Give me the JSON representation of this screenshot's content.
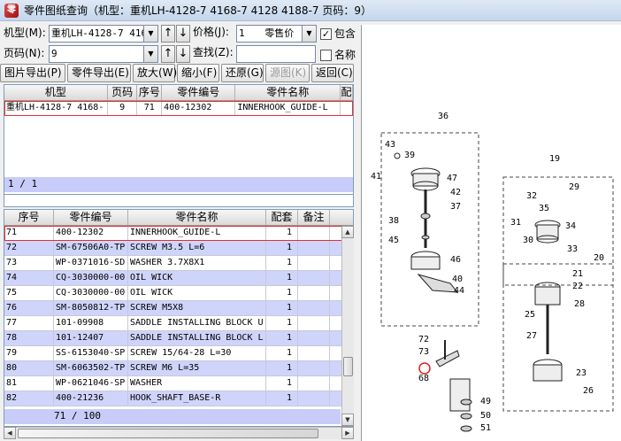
{
  "window": {
    "title": "零件图纸查询（机型：重机LH-4128-7 4168-7 4128 4188-7 页码：9）"
  },
  "filters": {
    "model_label": "机型(M):",
    "model_value": "重机LH-4128-7 4168",
    "page_label": "页码(N):",
    "page_value": "9",
    "price_label": "价格(J):",
    "price_qty": "1",
    "price_type": "零售价",
    "include_label": "包含",
    "include_checked": "✓",
    "find_label": "查找(Z):",
    "find_value": "",
    "name_label": "名称",
    "up_arrow": "↑",
    "down_arrow": "↓",
    "dropdown_glyph": "▼"
  },
  "toolbar": {
    "export_image": "图片导出(P)",
    "export_parts": "零件导出(E)",
    "zoom_in": "放大(W)",
    "zoom_out": "缩小(F)",
    "restore": "还原(G)",
    "source_image": "源图(K)",
    "back": "返回(C)"
  },
  "top_grid": {
    "headers": [
      "机型",
      "页码",
      "序号",
      "零件编号",
      "零件名称",
      "配"
    ],
    "rows": [
      {
        "model": "重机LH-4128-7 4168-",
        "page": "9",
        "seq": "71",
        "part_no": "400-12302",
        "name": "INNERHOOK_GUIDE-L"
      }
    ],
    "status": "1 / 1"
  },
  "bottom_grid": {
    "headers": [
      "序号",
      "零件编号",
      "零件名称",
      "配套",
      "备注"
    ],
    "rows": [
      {
        "seq": "71",
        "part_no": "400-12302",
        "name": "INNERHOOK_GUIDE-L",
        "qty": "1",
        "note": ""
      },
      {
        "seq": "72",
        "part_no": "SM-67506A0-TP",
        "name": "SCREW M3.5 L=6",
        "qty": "1",
        "note": ""
      },
      {
        "seq": "73",
        "part_no": "WP-0371016-SD",
        "name": "WASHER 3.7X8X1",
        "qty": "1",
        "note": ""
      },
      {
        "seq": "74",
        "part_no": "CQ-3030000-00",
        "name": "OIL WICK",
        "qty": "1",
        "note": ""
      },
      {
        "seq": "75",
        "part_no": "CQ-3030000-00",
        "name": "OIL WICK",
        "qty": "1",
        "note": ""
      },
      {
        "seq": "76",
        "part_no": "SM-8050812-TP",
        "name": "SCREW M5X8",
        "qty": "1",
        "note": ""
      },
      {
        "seq": "77",
        "part_no": "101-09908",
        "name": "SADDLE INSTALLING BLOCK U",
        "qty": "1",
        "note": ""
      },
      {
        "seq": "78",
        "part_no": "101-12407",
        "name": "SADDLE INSTALLING BLOCK L",
        "qty": "1",
        "note": ""
      },
      {
        "seq": "79",
        "part_no": "SS-6153040-SP",
        "name": "SCREW 15/64-28 L=30",
        "qty": "1",
        "note": ""
      },
      {
        "seq": "80",
        "part_no": "SM-6063502-TP",
        "name": "SCREW M6 L=35",
        "qty": "1",
        "note": ""
      },
      {
        "seq": "81",
        "part_no": "WP-0621046-SP",
        "name": "WASHER",
        "qty": "1",
        "note": ""
      },
      {
        "seq": "82",
        "part_no": "400-21236",
        "name": "HOOK_SHAFT_BASE-R",
        "qty": "1",
        "note": ""
      }
    ],
    "status": "71 / 100"
  },
  "drawing": {
    "callouts": [
      "36",
      "43",
      "39",
      "41",
      "47",
      "42",
      "37",
      "38",
      "45",
      "46",
      "40",
      "44",
      "19",
      "29",
      "32",
      "35",
      "31",
      "34",
      "30",
      "33",
      "20",
      "21",
      "22",
      "25",
      "27",
      "28",
      "23",
      "26",
      "72",
      "73",
      "68",
      "49",
      "50",
      "51"
    ]
  },
  "colors": {
    "alt_row": "#cfd4fb",
    "selection_border": "#e03030",
    "status_bg": "#c8ccf8"
  }
}
